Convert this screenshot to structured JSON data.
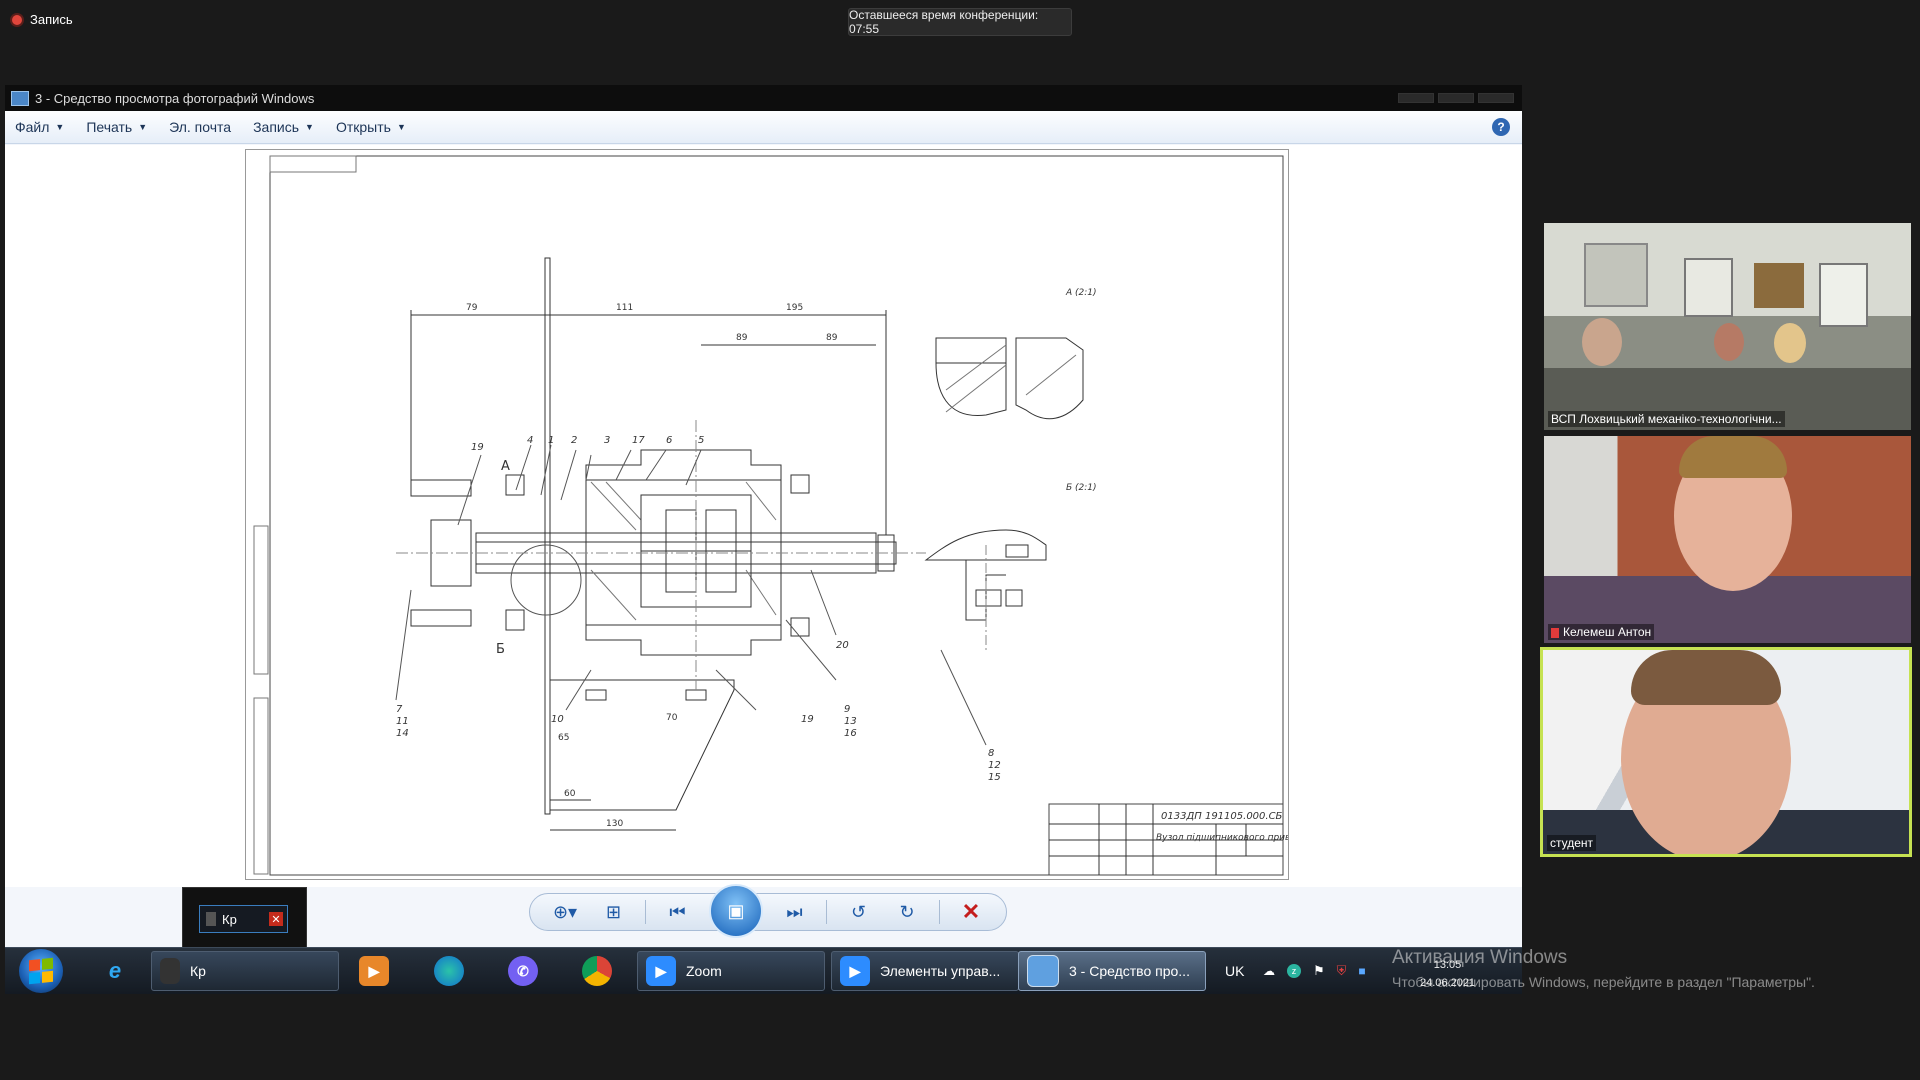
{
  "zoom": {
    "recording_label": "Запись",
    "timer_text": "Оставшееся время конференции: 07:55"
  },
  "viewer": {
    "title": "3 - Средство просмотра фотографий Windows",
    "menu": [
      {
        "label": "Файл",
        "dropdown": true
      },
      {
        "label": "Печать",
        "dropdown": true
      },
      {
        "label": "Эл. почта",
        "dropdown": false
      },
      {
        "label": "Запись",
        "dropdown": true
      },
      {
        "label": "Открыть",
        "dropdown": true
      }
    ],
    "help_glyph": "?",
    "drawing": {
      "title_block_code": "0133ДП 191105.000.СБ",
      "title_block_name": "Вузол підшипникового приводу",
      "view_a": "А (2:1)",
      "view_b": "Б (2:1)",
      "letter_a": "А",
      "letter_b": "Б",
      "dims": [
        "79",
        "111",
        "195",
        "89",
        "89",
        "60",
        "130",
        "70",
        "65"
      ],
      "balloons": [
        "19",
        "4",
        "1",
        "2",
        "3",
        "17",
        "6",
        "5",
        "20",
        "7",
        "11",
        "14",
        "10",
        "19",
        "9",
        "13",
        "16",
        "8",
        "12",
        "15"
      ]
    },
    "nav": {
      "zoom_icon": "magnifier-icon",
      "fit_icon": "actual-size-icon",
      "prev_icon": "previous-icon",
      "slideshow_icon": "slideshow-icon",
      "next_icon": "next-icon",
      "rotate_ccw_icon": "rotate-left-icon",
      "rotate_cw_icon": "rotate-right-icon",
      "delete_icon": "delete-icon"
    }
  },
  "preview": {
    "label": "Кр"
  },
  "taskbar": {
    "items": [
      {
        "label": "Кр",
        "active": false
      },
      {
        "label": "Zoom",
        "active": false
      },
      {
        "label": "Элементы управ...",
        "active": false
      },
      {
        "label": "3 - Средство про...",
        "active": true
      }
    ],
    "language": "UK",
    "time": "13:05",
    "date": "24.06.2021"
  },
  "activation": {
    "line1": "Активация Windows",
    "line2": "Чтобы активировать Windows, перейдите в раздел \"Параметры\"."
  },
  "participants": [
    {
      "name": "ВСП Лохвицький механіко-технологічни...",
      "muted": false
    },
    {
      "name": "Келемеш Антон",
      "muted": true
    },
    {
      "name": "студент",
      "muted": false,
      "speaking": true
    }
  ]
}
